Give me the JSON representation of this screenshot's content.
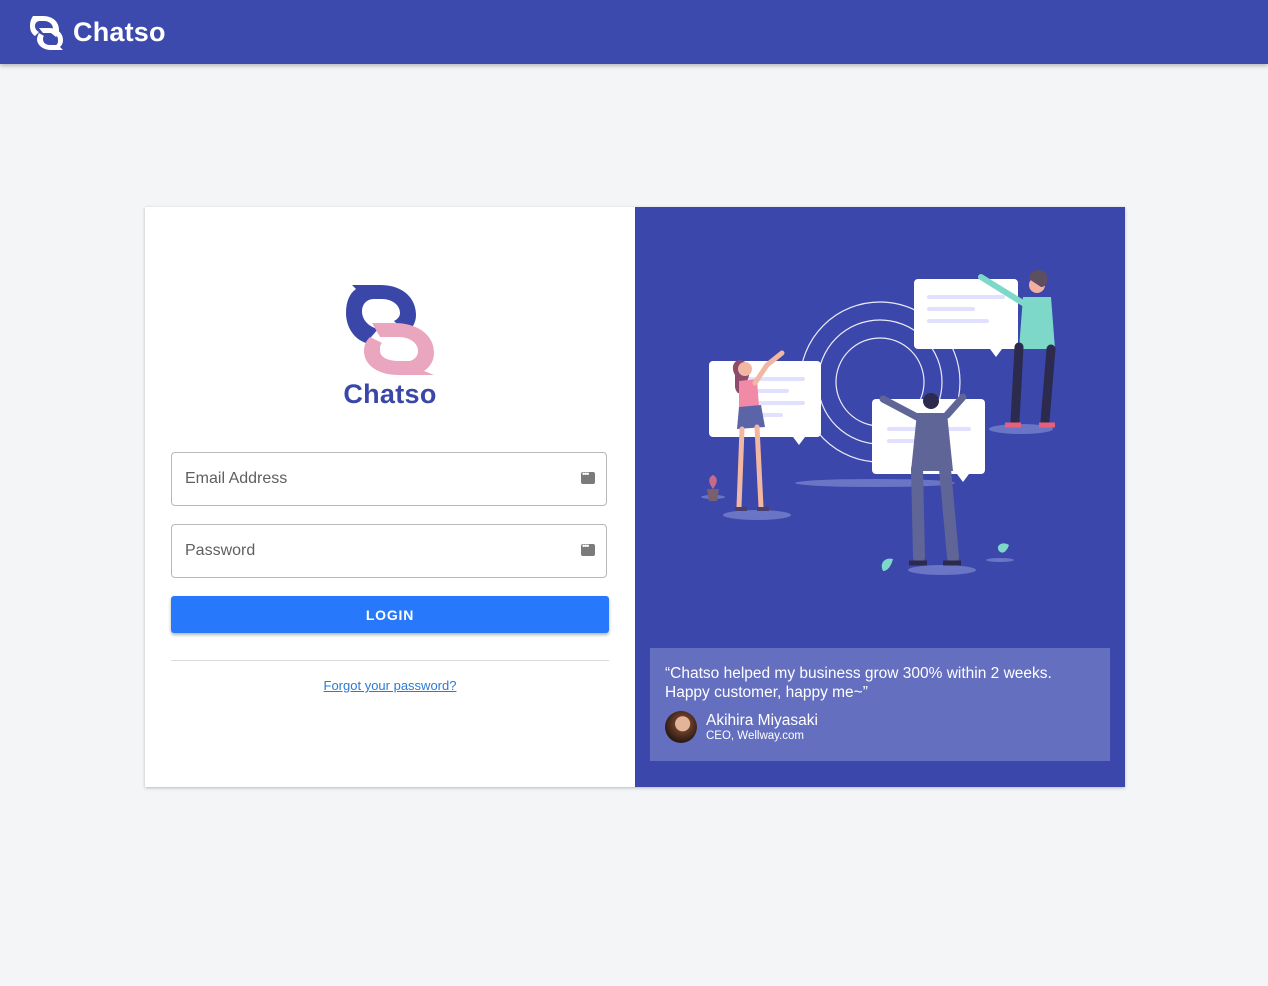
{
  "app": {
    "brand_name": "Chatso",
    "colors": {
      "primary": "#3d4aad",
      "accent": "#2778fa",
      "logo_pink": "#eaa6bf"
    }
  },
  "login": {
    "logo_text": "Chatso",
    "email_placeholder": "Email Address",
    "password_placeholder": "Password",
    "field_icon": "password-manager-key-icon",
    "login_label": "LOGIN",
    "forgot_label": "Forgot your password?"
  },
  "testimonial": {
    "quote": "“Chatso helped my business grow 300% within 2 weeks. Happy customer, happy me~”",
    "author_name": "Akihira Miyasaki",
    "author_title": "CEO, Wellway.com"
  }
}
